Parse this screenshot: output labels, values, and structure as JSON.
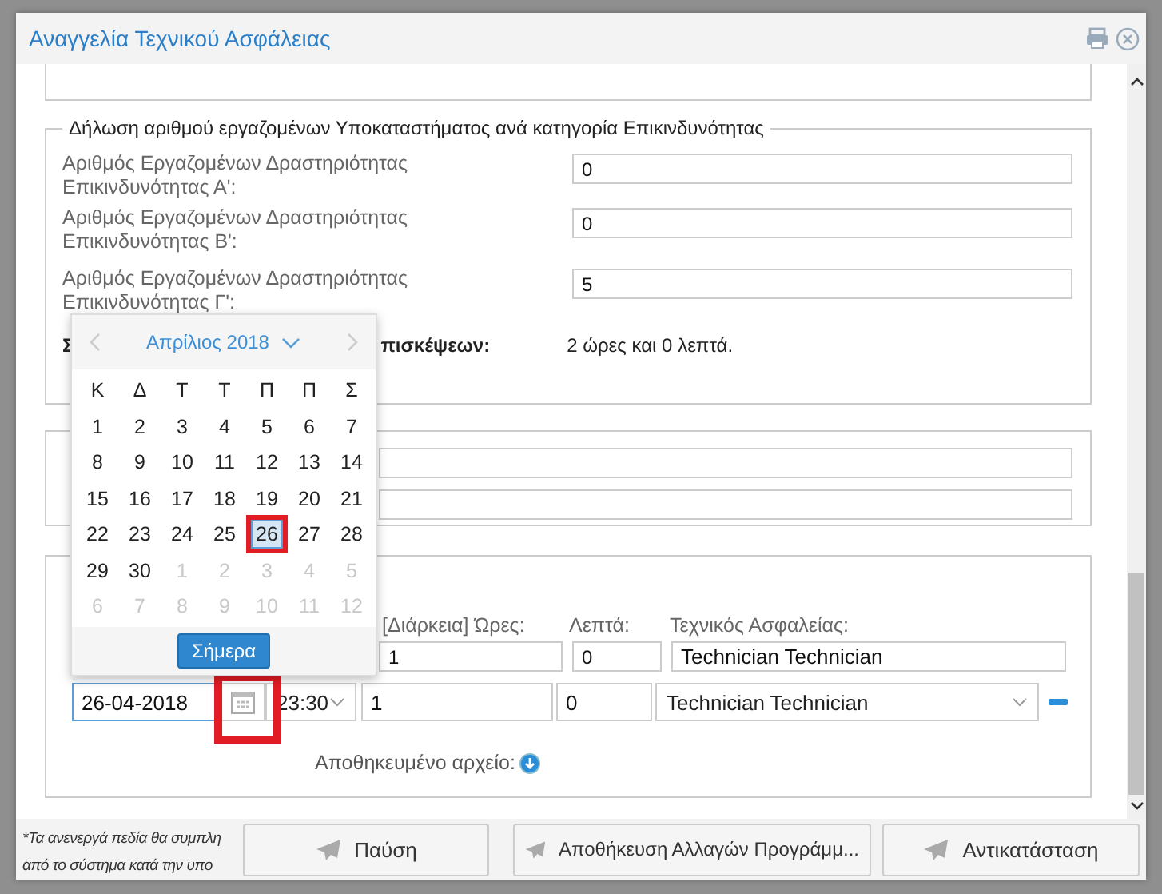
{
  "window": {
    "title": "Αναγγελία Τεχνικού Ασφάλειας"
  },
  "risk_section": {
    "legend": "Δήλωση αριθμού εργαζομένων Υποκαταστήματος ανά κατηγορία Επικινδυνότητας",
    "rows": [
      {
        "label": "Αριθμός Εργαζομένων Δραστηριότητας Επικινδυνότητας Α':",
        "value": "0"
      },
      {
        "label": "Αριθμός Εργαζομένων Δραστηριότητας Επικινδυνότητας Β':",
        "value": "0"
      },
      {
        "label": "Αριθμός Εργαζομένων Δραστηριότητας Επικινδυνότητας Γ':",
        "value": "5"
      }
    ],
    "summary_label_start": "Σ",
    "summary_label_end": "πισκέψεων:",
    "summary_value": "2 ώρες και 0 λεπτά."
  },
  "visits_section": {
    "headers": [
      "[Διάρκεια] Ώρες:",
      "Λεπτά:",
      "Τεχνικός Ασφαλείας:"
    ],
    "row_1": {
      "hours": "1",
      "minutes": "0",
      "technician": "Technician Technician"
    },
    "row_2": {
      "date": "26-04-2018",
      "focused": true,
      "calendar_button_highlighted": true,
      "time": "23:30",
      "hours": "1",
      "minutes": "0",
      "technician": "Technician Technician"
    },
    "saved_file_label": "Αποθηκευμένο αρχείο:"
  },
  "date_picker": {
    "month_label": "Απρίλιος 2018",
    "weekdays": [
      "Κ",
      "Δ",
      "Τ",
      "Τ",
      "Π",
      "Π",
      "Σ"
    ],
    "days": [
      {
        "label": "1",
        "other_month": false,
        "selected": false,
        "highlighted": false
      },
      {
        "label": "2",
        "other_month": false,
        "selected": false,
        "highlighted": false
      },
      {
        "label": "3",
        "other_month": false,
        "selected": false,
        "highlighted": false
      },
      {
        "label": "4",
        "other_month": false,
        "selected": false,
        "highlighted": false
      },
      {
        "label": "5",
        "other_month": false,
        "selected": false,
        "highlighted": false
      },
      {
        "label": "6",
        "other_month": false,
        "selected": false,
        "highlighted": false
      },
      {
        "label": "7",
        "other_month": false,
        "selected": false,
        "highlighted": false
      },
      {
        "label": "8",
        "other_month": false,
        "selected": false,
        "highlighted": false
      },
      {
        "label": "9",
        "other_month": false,
        "selected": false,
        "highlighted": false
      },
      {
        "label": "10",
        "other_month": false,
        "selected": false,
        "highlighted": false
      },
      {
        "label": "11",
        "other_month": false,
        "selected": false,
        "highlighted": false
      },
      {
        "label": "12",
        "other_month": false,
        "selected": false,
        "highlighted": false
      },
      {
        "label": "13",
        "other_month": false,
        "selected": false,
        "highlighted": false
      },
      {
        "label": "14",
        "other_month": false,
        "selected": false,
        "highlighted": false
      },
      {
        "label": "15",
        "other_month": false,
        "selected": false,
        "highlighted": false
      },
      {
        "label": "16",
        "other_month": false,
        "selected": false,
        "highlighted": false
      },
      {
        "label": "17",
        "other_month": false,
        "selected": false,
        "highlighted": false
      },
      {
        "label": "18",
        "other_month": false,
        "selected": false,
        "highlighted": false
      },
      {
        "label": "19",
        "other_month": false,
        "selected": false,
        "highlighted": false
      },
      {
        "label": "20",
        "other_month": false,
        "selected": false,
        "highlighted": false
      },
      {
        "label": "21",
        "other_month": false,
        "selected": false,
        "highlighted": false
      },
      {
        "label": "22",
        "other_month": false,
        "selected": false,
        "highlighted": false
      },
      {
        "label": "23",
        "other_month": false,
        "selected": false,
        "highlighted": false
      },
      {
        "label": "24",
        "other_month": false,
        "selected": false,
        "highlighted": false
      },
      {
        "label": "25",
        "other_month": false,
        "selected": false,
        "highlighted": false
      },
      {
        "label": "26",
        "other_month": false,
        "selected": true,
        "highlighted": true
      },
      {
        "label": "27",
        "other_month": false,
        "selected": false,
        "highlighted": false
      },
      {
        "label": "28",
        "other_month": false,
        "selected": false,
        "highlighted": false
      },
      {
        "label": "29",
        "other_month": false,
        "selected": false,
        "highlighted": false
      },
      {
        "label": "30",
        "other_month": false,
        "selected": false,
        "highlighted": false
      },
      {
        "label": "1",
        "other_month": true,
        "selected": false,
        "highlighted": false
      },
      {
        "label": "2",
        "other_month": true,
        "selected": false,
        "highlighted": false
      },
      {
        "label": "3",
        "other_month": true,
        "selected": false,
        "highlighted": false
      },
      {
        "label": "4",
        "other_month": true,
        "selected": false,
        "highlighted": false
      },
      {
        "label": "5",
        "other_month": true,
        "selected": false,
        "highlighted": false
      },
      {
        "label": "6",
        "other_month": true,
        "selected": false,
        "highlighted": false
      },
      {
        "label": "7",
        "other_month": true,
        "selected": false,
        "highlighted": false
      },
      {
        "label": "8",
        "other_month": true,
        "selected": false,
        "highlighted": false
      },
      {
        "label": "9",
        "other_month": true,
        "selected": false,
        "highlighted": false
      },
      {
        "label": "10",
        "other_month": true,
        "selected": false,
        "highlighted": false
      },
      {
        "label": "11",
        "other_month": true,
        "selected": false,
        "highlighted": false
      },
      {
        "label": "12",
        "other_month": true,
        "selected": false,
        "highlighted": false
      }
    ],
    "today_button": "Σήμερα"
  },
  "footer": {
    "note_lines": [
      "*Τα ανενεργά πεδία θα συμπλη",
      "από το σύστημα κατά την υπο"
    ],
    "buttons": [
      "Παύση",
      "Αποθήκευση Αλλαγών Προγράμμ...",
      "Αντικατάσταση"
    ]
  }
}
